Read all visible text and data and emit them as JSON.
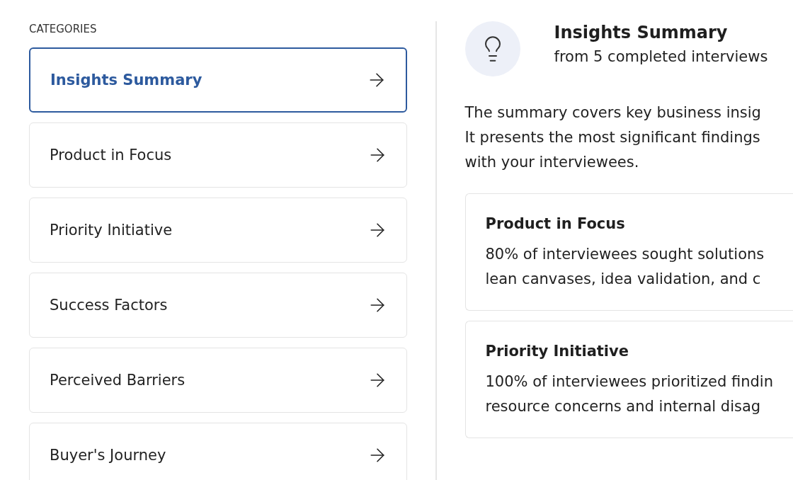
{
  "sidebar": {
    "heading": "CATEGORIES",
    "items": [
      {
        "label": "Insights Summary",
        "selected": true
      },
      {
        "label": "Product in Focus",
        "selected": false
      },
      {
        "label": "Priority Initiative",
        "selected": false
      },
      {
        "label": "Success Factors",
        "selected": false
      },
      {
        "label": "Perceived Barriers",
        "selected": false
      },
      {
        "label": "Buyer's Journey",
        "selected": false
      }
    ]
  },
  "summary": {
    "title": "Insights Summary",
    "subtitle": "from 5 completed interviews",
    "intro_lines": [
      "The summary covers key business insig",
      "It presents the most significant findings",
      "with your interviewees."
    ],
    "cards": [
      {
        "title": "Product in Focus",
        "lines": [
          "80% of interviewees sought solutions",
          "lean canvases, idea validation, and c"
        ]
      },
      {
        "title": "Priority Initiative",
        "lines": [
          "100% of interviewees prioritized findin",
          "resource concerns and internal disag"
        ]
      }
    ]
  }
}
